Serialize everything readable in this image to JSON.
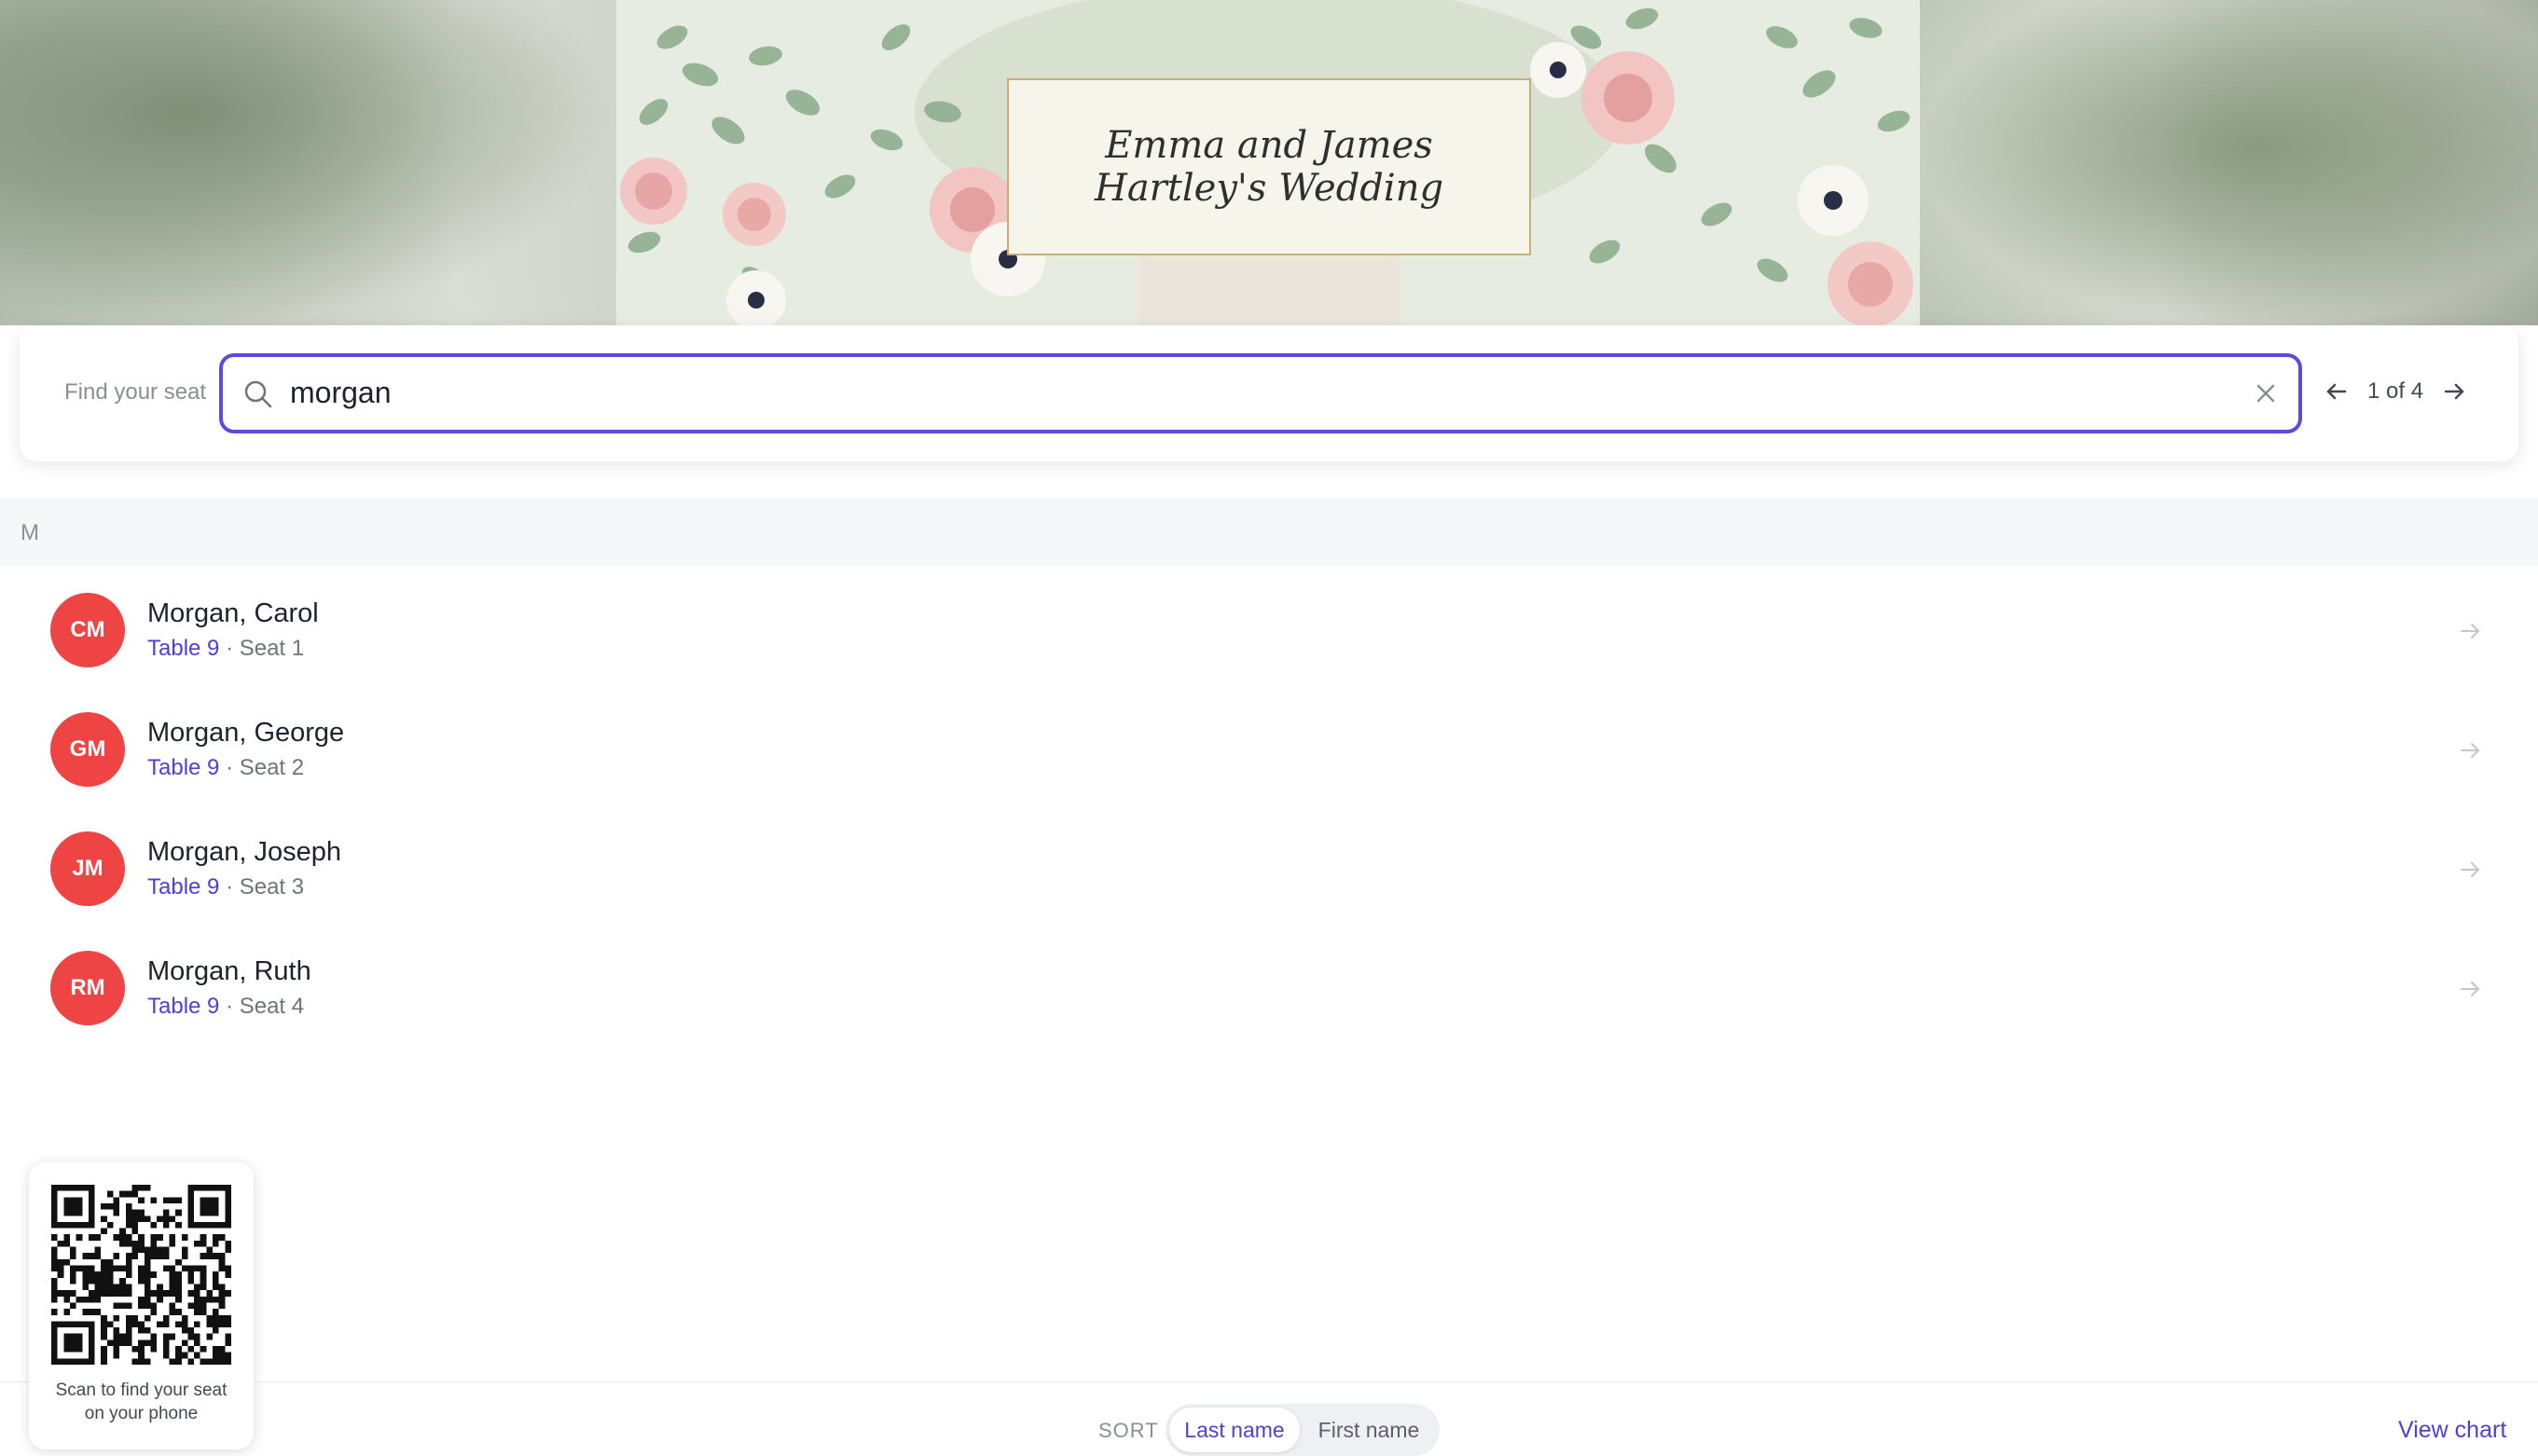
{
  "event": {
    "title": "Emma and James Hartley's Wedding"
  },
  "search": {
    "label": "Find your seat",
    "value": "morgan",
    "pager": "1 of 4"
  },
  "group": {
    "letter": "M"
  },
  "guests": [
    {
      "initials": "CM",
      "name": "Morgan, Carol",
      "table": "Table 9",
      "seat": "· Seat 1"
    },
    {
      "initials": "GM",
      "name": "Morgan, George",
      "table": "Table 9",
      "seat": "· Seat 2"
    },
    {
      "initials": "JM",
      "name": "Morgan, Joseph",
      "table": "Table 9",
      "seat": "· Seat 3"
    },
    {
      "initials": "RM",
      "name": "Morgan, Ruth",
      "table": "Table 9",
      "seat": "· Seat 4"
    }
  ],
  "sort": {
    "label": "SORT",
    "options": [
      "Last name",
      "First name"
    ],
    "selected": "Last name"
  },
  "view_chart": "View chart",
  "qr": {
    "caption": "Scan to find your seat on your phone"
  },
  "colors": {
    "accent": "#4f3fd9",
    "avatar": "#ef4444",
    "search_border": "#5a4ce0"
  },
  "icons": [
    "search-icon",
    "close-icon",
    "arrow-left-icon",
    "arrow-right-icon",
    "qr-code"
  ]
}
